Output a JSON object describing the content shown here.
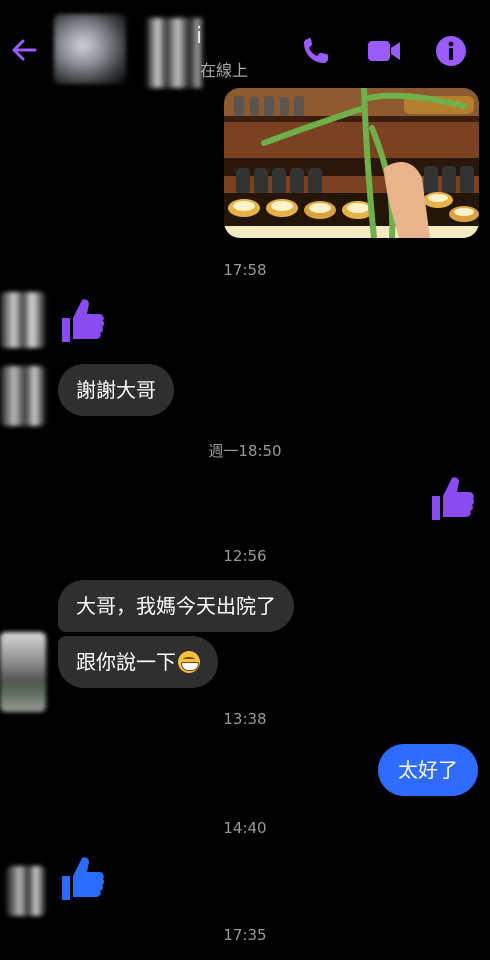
{
  "header": {
    "contact_name_suffix": "i",
    "status": "在線上",
    "colors": {
      "accent": "#9b5cff",
      "background": "#000000"
    },
    "icons": [
      "back-arrow-icon",
      "phone-call-icon",
      "video-call-icon",
      "info-icon"
    ]
  },
  "messages": [
    {
      "type": "image",
      "from": "me"
    },
    {
      "type": "timestamp",
      "text": "17:58"
    },
    {
      "type": "reaction",
      "from": "peer",
      "icon": "thumbs-up-icon",
      "color": "#8a4cf0"
    },
    {
      "type": "text",
      "from": "peer",
      "text": "謝謝大哥"
    },
    {
      "type": "timestamp",
      "text": "週一18:50"
    },
    {
      "type": "reaction",
      "from": "me",
      "icon": "thumbs-up-icon",
      "color": "#8a4cf0"
    },
    {
      "type": "timestamp",
      "text": "12:56"
    },
    {
      "type": "text",
      "from": "peer",
      "text": "大哥，我媽今天出院了"
    },
    {
      "type": "text",
      "from": "peer",
      "text": "跟你說一下"
    },
    {
      "type": "timestamp",
      "text": "13:38"
    },
    {
      "type": "text",
      "from": "me",
      "text": "太好了",
      "color": "#2f6bff"
    },
    {
      "type": "timestamp",
      "text": "14:40"
    },
    {
      "type": "reaction",
      "from": "peer",
      "icon": "thumbs-up-icon",
      "color": "#2a6cff"
    },
    {
      "type": "timestamp",
      "text": "17:35"
    }
  ],
  "emoji_after_message_8": "grinning-face-emoji"
}
